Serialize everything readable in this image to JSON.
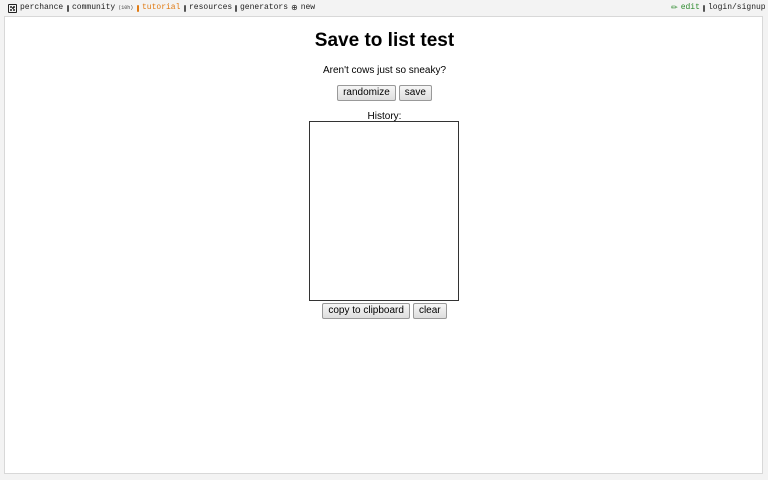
{
  "topbar": {
    "brand": "perchance",
    "community": "community",
    "community_count": "(10h)",
    "tutorial": "tutorial",
    "resources": "resources",
    "generators": "generators",
    "new": "new",
    "edit": "edit",
    "login": "login/signup",
    "accent_color": "#e07b14",
    "edit_color": "#2e8b2e"
  },
  "main": {
    "title": "Save to list test",
    "output_text": "Aren't cows just so sneaky?",
    "randomize_label": "randomize",
    "save_label": "save",
    "history_label": "History:",
    "history_value": "",
    "copy_label": "copy to clipboard",
    "clear_label": "clear"
  }
}
